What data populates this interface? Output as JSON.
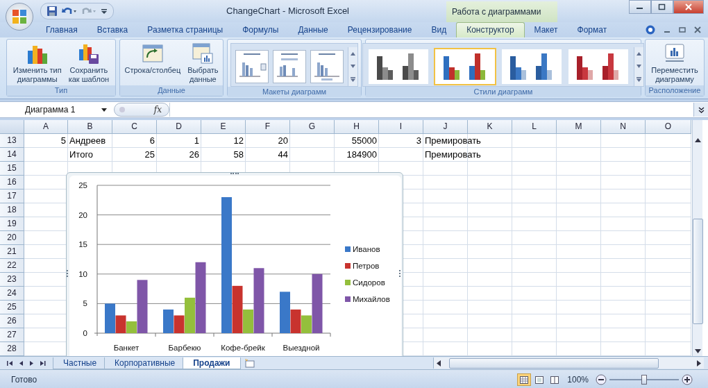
{
  "window": {
    "title": "ChangeChart - Microsoft Excel",
    "context_title": "Работа с диаграммами"
  },
  "tabs": [
    {
      "label": "Главная",
      "selected": false
    },
    {
      "label": "Вставка",
      "selected": false
    },
    {
      "label": "Разметка страницы",
      "selected": false
    },
    {
      "label": "Формулы",
      "selected": false
    },
    {
      "label": "Данные",
      "selected": false
    },
    {
      "label": "Рецензирование",
      "selected": false
    },
    {
      "label": "Вид",
      "selected": false
    },
    {
      "label": "Конструктор",
      "selected": true
    },
    {
      "label": "Макет",
      "selected": false
    },
    {
      "label": "Формат",
      "selected": false
    }
  ],
  "ribbon": {
    "groups": [
      {
        "kind": "buttons",
        "label": "Тип",
        "buttons": [
          "Изменить тип\nдиаграммы",
          "Сохранить\nкак шаблон"
        ]
      },
      {
        "kind": "buttons",
        "label": "Данные",
        "buttons": [
          "Строка/столбец",
          "Выбрать\nданные"
        ]
      },
      {
        "kind": "layouts",
        "label": "Макеты диаграмм"
      },
      {
        "kind": "styles",
        "label": "Стили диаграмм",
        "styles": [
          {
            "selected": false
          },
          {
            "selected": true
          },
          {
            "selected": false
          },
          {
            "selected": false
          }
        ]
      },
      {
        "kind": "buttons",
        "label": "Расположение",
        "buttons": [
          "Переместить\nдиаграмму"
        ]
      }
    ]
  },
  "formula_bar": {
    "name_box": "Диаграмма 1",
    "function_label": "fx"
  },
  "sheet": {
    "columns": [
      "A",
      "B",
      "C",
      "D",
      "E",
      "F",
      "G",
      "H",
      "I",
      "J",
      "K",
      "L",
      "M",
      "N",
      "O"
    ],
    "rows": [
      {
        "number": "13",
        "cells": {
          "A": {
            "text": "5",
            "kind": "number"
          },
          "B": {
            "text": "Андреев",
            "kind": "text"
          },
          "C": {
            "text": "6",
            "kind": "number"
          },
          "D": {
            "text": "1",
            "kind": "number"
          },
          "E": {
            "text": "12",
            "kind": "number"
          },
          "F": {
            "text": "20",
            "kind": "number"
          },
          "H": {
            "text": "55000",
            "kind": "number"
          },
          "I": {
            "text": "3",
            "kind": "number"
          },
          "J": {
            "text": "Премировать",
            "kind": "text"
          }
        }
      },
      {
        "number": "14",
        "cells": {
          "B": {
            "text": "Итого",
            "kind": "text"
          },
          "C": {
            "text": "25",
            "kind": "number"
          },
          "D": {
            "text": "26",
            "kind": "number"
          },
          "E": {
            "text": "58",
            "kind": "number"
          },
          "F": {
            "text": "44",
            "kind": "number"
          },
          "H": {
            "text": "184900",
            "kind": "number"
          },
          "J": {
            "text": "Премировать",
            "kind": "text"
          }
        }
      },
      {
        "number": "15"
      },
      {
        "number": "16"
      },
      {
        "number": "17"
      },
      {
        "number": "18"
      },
      {
        "number": "19"
      },
      {
        "number": "20"
      },
      {
        "number": "21"
      },
      {
        "number": "22"
      },
      {
        "number": "23"
      },
      {
        "number": "24"
      },
      {
        "number": "25"
      },
      {
        "number": "26"
      },
      {
        "number": "27"
      },
      {
        "number": "28"
      }
    ],
    "chart": {
      "chart_data": {
        "type": "bar",
        "categories": [
          "Банкет",
          "Барбекю",
          "Кофе-брейк",
          "Выездной"
        ],
        "series": [
          {
            "name": "Иванов",
            "color": "#3a78c8",
            "values": [
              5,
              4,
              23,
              7
            ]
          },
          {
            "name": "Петров",
            "color": "#c8332e",
            "values": [
              3,
              3,
              8,
              4
            ]
          },
          {
            "name": "Сидоров",
            "color": "#94bf3c",
            "values": [
              2,
              6,
              4,
              3
            ]
          },
          {
            "name": "Михайлов",
            "color": "#7f56a8",
            "values": [
              9,
              12,
              11,
              10
            ]
          }
        ],
        "ylim": [
          0,
          25
        ],
        "yticks": [
          0,
          5,
          10,
          15,
          20,
          25
        ],
        "grid": true,
        "legend": "right"
      }
    }
  },
  "sheet_tabs": [
    {
      "label": "Частные",
      "selected": false
    },
    {
      "label": "Корпоративные",
      "selected": false
    },
    {
      "label": "Продажи",
      "selected": true
    }
  ],
  "status_bar": {
    "status": "Готово",
    "view_buttons": [
      {
        "selected": true
      },
      {
        "selected": false
      },
      {
        "selected": false
      }
    ],
    "zoom": "100%",
    "zoom_slider": {
      "level": 0.5
    }
  }
}
